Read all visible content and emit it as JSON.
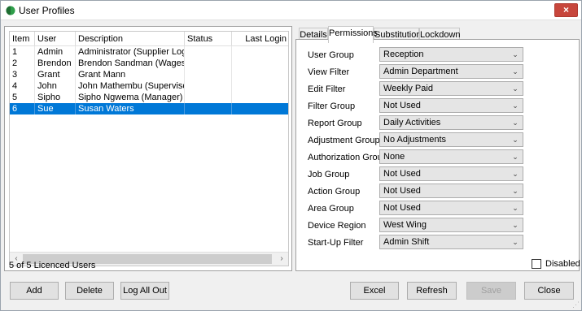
{
  "window": {
    "title": "User Profiles",
    "close_label": "×"
  },
  "grid": {
    "columns": [
      "Item",
      "User",
      "Description",
      "Status",
      "Last Login"
    ],
    "rows": [
      {
        "item": "1",
        "user": "Admin",
        "description": "Administrator (Supplier Login)",
        "status": "",
        "last_login": ""
      },
      {
        "item": "2",
        "user": "Brendon",
        "description": "Brendon Sandman (Wages)",
        "status": "",
        "last_login": ""
      },
      {
        "item": "3",
        "user": "Grant",
        "description": "Grant Mann",
        "status": "",
        "last_login": ""
      },
      {
        "item": "4",
        "user": "John",
        "description": "John Mathembu (Supervisor)",
        "status": "",
        "last_login": ""
      },
      {
        "item": "5",
        "user": "Sipho",
        "description": "Sipho Ngwema (Manager)",
        "status": "",
        "last_login": ""
      },
      {
        "item": "6",
        "user": "Sue",
        "description": "Susan Waters",
        "status": "",
        "last_login": ""
      }
    ],
    "selected_row": 6,
    "scroll_left": "‹",
    "scroll_right": "›"
  },
  "license_text": "5 of 5 Licenced Users",
  "tabs": [
    "Details",
    "Permissions",
    "Substitution",
    "Lockdown"
  ],
  "active_tab": "Permissions",
  "permissions": [
    {
      "label": "User Group",
      "value": "Reception"
    },
    {
      "label": "View Filter",
      "value": "Admin Department"
    },
    {
      "label": "Edit Filter",
      "value": "Weekly Paid"
    },
    {
      "label": "Filter Group",
      "value": "Not Used"
    },
    {
      "label": "Report Group",
      "value": "Daily Activities"
    },
    {
      "label": "Adjustment Group",
      "value": "No Adjustments"
    },
    {
      "label": "Authorization Group",
      "value": "None"
    },
    {
      "label": "Job Group",
      "value": "Not Used"
    },
    {
      "label": "Action Group",
      "value": "Not Used"
    },
    {
      "label": "Area Group",
      "value": "Not Used"
    },
    {
      "label": "Device Region",
      "value": "West Wing"
    },
    {
      "label": "Start-Up Filter",
      "value": "Admin Shift"
    }
  ],
  "disabled_checkbox": {
    "label": "Disabled",
    "checked": false
  },
  "buttons": {
    "add": "Add",
    "delete": "Delete",
    "log_all_out": "Log All Out",
    "excel": "Excel",
    "refresh": "Refresh",
    "save": "Save",
    "close": "Close"
  },
  "colors": {
    "selection": "#0078d7",
    "close_button": "#c7463c",
    "app_icon": "#2e9e4a"
  }
}
